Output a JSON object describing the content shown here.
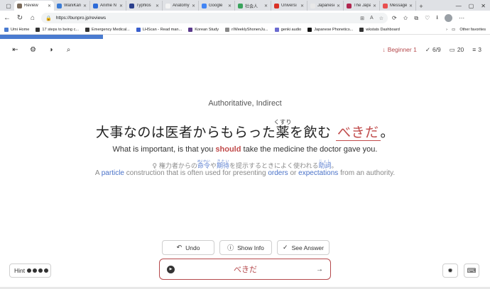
{
  "browser": {
    "tabs": [
      {
        "label": "Review",
        "color": "#7a6a5a",
        "active": true
      },
      {
        "label": "WaniKani",
        "color": "#3a7bd5"
      },
      {
        "label": "Anime N",
        "color": "#2d6bd8"
      },
      {
        "label": "Typhlos",
        "color": "#2b3f8c"
      },
      {
        "label": "Anatomy",
        "color": "#f3f3f3"
      },
      {
        "label": "Google",
        "color": "#4285f4"
      },
      {
        "label": "社会人",
        "color": "#3aa35c"
      },
      {
        "label": "Universi",
        "color": "#d93025"
      },
      {
        "label": "Japanese",
        "color": "#e8e8e8"
      },
      {
        "label": "The Japa",
        "color": "#b0264f"
      },
      {
        "label": "Message",
        "color": "#e94f4f"
      }
    ],
    "new_tab": "+",
    "url": "https://bunpro.jp/reviews",
    "bookmarks": [
      {
        "label": "Umi Home",
        "color": "#4a7bd0"
      },
      {
        "label": "17 steps to being c...",
        "color": "#333"
      },
      {
        "label": "Emergency Medical...",
        "color": "#333"
      },
      {
        "label": "LHScan - Read man...",
        "color": "#3a5fcd"
      },
      {
        "label": "Korean Study",
        "color": "#5b3b8c"
      },
      {
        "label": "r/WeeklyShonenJu...",
        "color": "#888"
      },
      {
        "label": "genki audio",
        "color": "#6b6bd0"
      },
      {
        "label": "Japanese Phonetics...",
        "color": "#111"
      },
      {
        "label": "wkstats Dashboard",
        "color": "#333"
      }
    ],
    "other_favorites": "Other favorites"
  },
  "app": {
    "level": "Beginner 1",
    "progress": "6/9",
    "reviews": "20",
    "streak": "3",
    "progress_fraction": 0.21,
    "hint_line": "Authoritative, Indirect",
    "sentence": {
      "pre": "大事なのは医者からもらった",
      "kanji": "薬",
      "furigana": "くすり",
      "mid": "を飲む",
      "answer": "べきだ",
      "end": "。"
    },
    "translation": {
      "pre": "What is important, is that you ",
      "highlight": "should",
      "post": " take the medicine the doctor gave you."
    },
    "meaning_jp": {
      "pre": "権力者からの",
      "w1": "命令",
      "mid1": "や",
      "w2": "期待",
      "mid2": "を提示するときによく使われる",
      "w3": "助詞",
      "end": "。",
      "r1": "めいれい",
      "r2": "きたい",
      "r3": "じょし"
    },
    "meaning_en": {
      "pre": "A ",
      "w1": "particle",
      "mid1": " construction that is often used for presenting ",
      "w2": "orders",
      "mid2": " or ",
      "w3": "expectations",
      "end": " from an authority."
    },
    "buttons": {
      "undo": "Undo",
      "show_info": "Show Info",
      "see_answer": "See Answer"
    },
    "hint_label": "Hint",
    "answer_value": "べきだ",
    "accent_color": "#b5484b",
    "link_color": "#4a72c8"
  }
}
